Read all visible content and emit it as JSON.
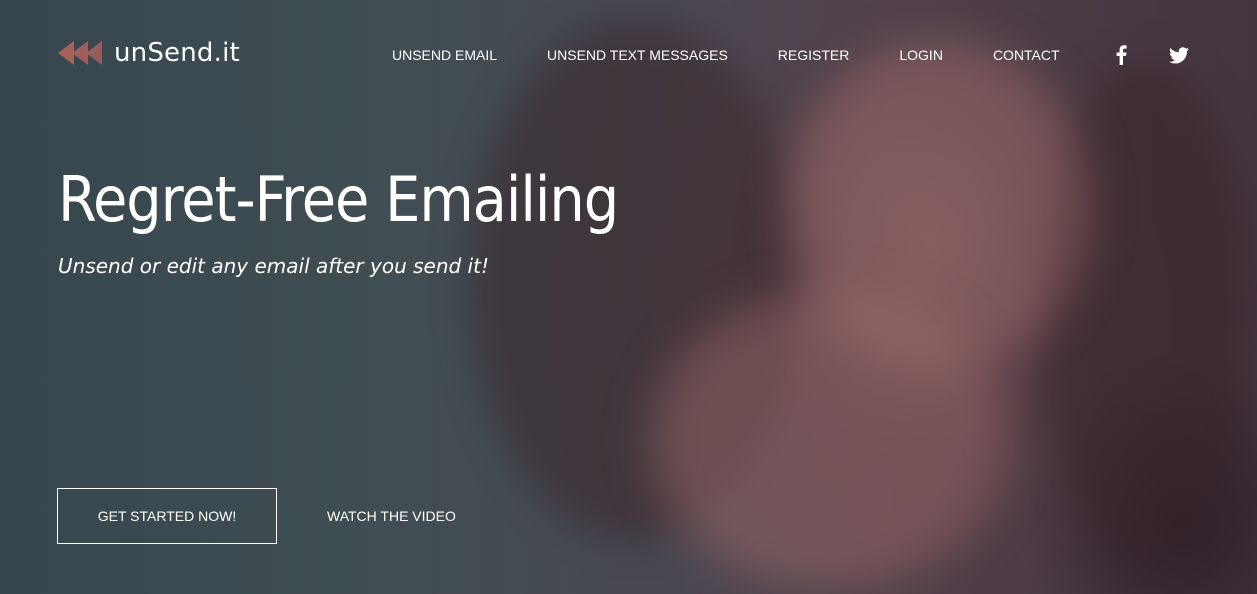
{
  "brand": {
    "name": "unSend.it",
    "logo_icon": "triple-rewind-arrows-icon",
    "logo_color": "#a8625a"
  },
  "nav": {
    "items": [
      {
        "label": "UNSEND EMAIL"
      },
      {
        "label": "UNSEND TEXT MESSAGES"
      },
      {
        "label": "REGISTER"
      },
      {
        "label": "LOGIN"
      },
      {
        "label": "CONTACT"
      }
    ],
    "social": [
      {
        "icon": "facebook-icon"
      },
      {
        "icon": "twitter-icon"
      }
    ]
  },
  "hero": {
    "headline": "Regret-Free Emailing",
    "subheadline": "Unsend or edit any email after you send it!",
    "primary_cta": "GET STARTED NOW!",
    "secondary_cta": "WATCH THE VIDEO",
    "background": "photo-woman-covering-mouth-looking-at-phone"
  },
  "colors": {
    "text": "#ffffff",
    "overlay_left": "#3f4f56",
    "overlay_right": "#4a3a44"
  }
}
